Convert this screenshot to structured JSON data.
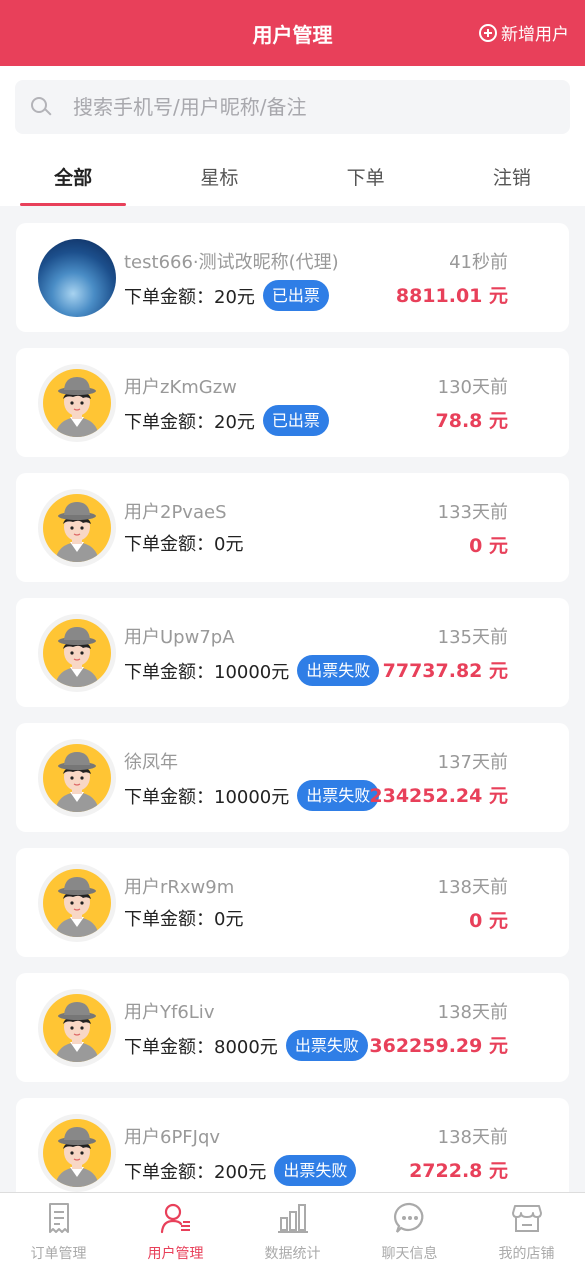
{
  "header": {
    "title": "用户管理",
    "add_label": "新增用户"
  },
  "search": {
    "placeholder": "搜索手机号/用户昵称/备注"
  },
  "tabs": [
    {
      "label": "全部",
      "active": true
    },
    {
      "label": "星标",
      "active": false
    },
    {
      "label": "下单",
      "active": false
    },
    {
      "label": "注销",
      "active": false
    }
  ],
  "amount_label": "下单金额：",
  "users": [
    {
      "avatar": "planet",
      "name": "test666·测试改昵称(代理)",
      "time": "41秒前",
      "amount": "20元",
      "badge": "已出票",
      "total": "8811.01 元"
    },
    {
      "avatar": "default",
      "name": "用户zKmGzw",
      "time": "130天前",
      "amount": "20元",
      "badge": "已出票",
      "total": "78.8 元"
    },
    {
      "avatar": "default",
      "name": "用户2PvaeS",
      "time": "133天前",
      "amount": "0元",
      "badge": "",
      "total": "0 元"
    },
    {
      "avatar": "default",
      "name": "用户Upw7pA",
      "time": "135天前",
      "amount": "10000元",
      "badge": "出票失败",
      "total": "77737.82 元"
    },
    {
      "avatar": "default",
      "name": "徐凤年",
      "time": "137天前",
      "amount": "10000元",
      "badge": "出票失败",
      "total": "234252.24 元"
    },
    {
      "avatar": "default",
      "name": "用户rRxw9m",
      "time": "138天前",
      "amount": "0元",
      "badge": "",
      "total": "0 元"
    },
    {
      "avatar": "default",
      "name": "用户Yf6Liv",
      "time": "138天前",
      "amount": "8000元",
      "badge": "出票失败",
      "total": "362259.29 元"
    },
    {
      "avatar": "default",
      "name": "用户6PFJqv",
      "time": "138天前",
      "amount": "200元",
      "badge": "出票失败",
      "total": "2722.8 元"
    }
  ],
  "nav": [
    {
      "label": "订单管理",
      "icon": "receipt-icon",
      "active": false
    },
    {
      "label": "用户管理",
      "icon": "user-list-icon",
      "active": true
    },
    {
      "label": "数据统计",
      "icon": "bar-chart-icon",
      "active": false
    },
    {
      "label": "聊天信息",
      "icon": "chat-icon",
      "active": false
    },
    {
      "label": "我的店铺",
      "icon": "shop-icon",
      "active": false
    }
  ],
  "colors": {
    "brand": "#e8405a",
    "badge": "#2f7ee6",
    "avatar_bg": "#ffc534"
  }
}
